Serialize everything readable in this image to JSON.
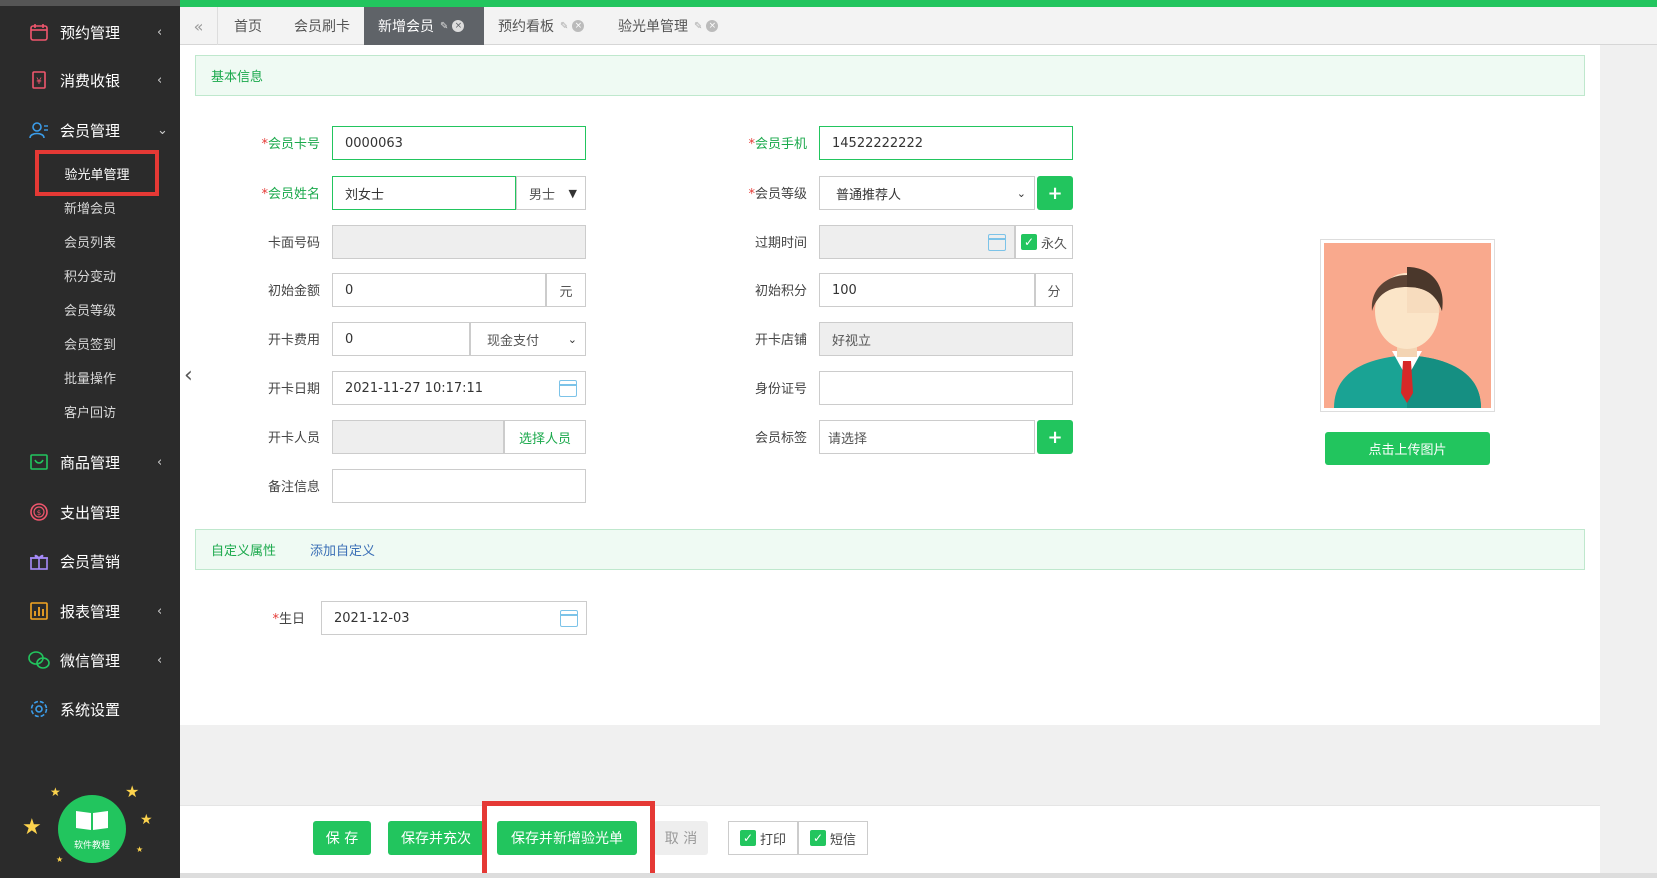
{
  "sidebar": {
    "menu": [
      {
        "label": "预约管理",
        "icon": "calendar-icon",
        "arrow": "‹"
      },
      {
        "label": "消费收银",
        "icon": "receipt-icon",
        "arrow": "‹"
      },
      {
        "label": "会员管理",
        "icon": "member-icon",
        "arrow": "⌄"
      },
      {
        "label": "商品管理",
        "icon": "product-icon",
        "arrow": "‹"
      },
      {
        "label": "支出管理",
        "icon": "expense-icon",
        "arrow": ""
      },
      {
        "label": "会员营销",
        "icon": "gift-icon",
        "arrow": ""
      },
      {
        "label": "报表管理",
        "icon": "report-icon",
        "arrow": "‹"
      },
      {
        "label": "微信管理",
        "icon": "wechat-icon",
        "arrow": "‹"
      },
      {
        "label": "系统设置",
        "icon": "gear-icon",
        "arrow": ""
      }
    ],
    "submenu": [
      "验光单管理",
      "新增会员",
      "会员列表",
      "积分变动",
      "会员等级",
      "会员签到",
      "批量操作",
      "客户回访"
    ],
    "tutorial_label": "软件教程"
  },
  "tabs": [
    {
      "label": "首页"
    },
    {
      "label": "会员刷卡"
    },
    {
      "label": "新增会员",
      "active": true
    },
    {
      "label": "预约看板"
    },
    {
      "label": "验光单管理"
    }
  ],
  "basic_section": {
    "title": "基本信息"
  },
  "form": {
    "card_no": {
      "label": "会员卡号",
      "value": "0000063"
    },
    "phone": {
      "label": "会员手机",
      "value": "14522222222"
    },
    "name": {
      "label": "会员姓名",
      "value": "刘女士",
      "gender": "男士"
    },
    "level": {
      "label": "会员等级",
      "value": "普通推荐人"
    },
    "face_no": {
      "label": "卡面号码",
      "value": ""
    },
    "expire": {
      "label": "过期时间",
      "value": "",
      "forever": "永久"
    },
    "init_amount": {
      "label": "初始金额",
      "value": "0",
      "unit": "元"
    },
    "init_points": {
      "label": "初始积分",
      "value": "100",
      "unit": "分"
    },
    "open_fee": {
      "label": "开卡费用",
      "value": "0",
      "pay_method": "现金支付"
    },
    "open_store": {
      "label": "开卡店铺",
      "value": "好视立"
    },
    "open_date": {
      "label": "开卡日期",
      "value": "2021-11-27 10:17:11"
    },
    "id_card": {
      "label": "身份证号",
      "value": ""
    },
    "open_staff": {
      "label": "开卡人员",
      "value": "",
      "select_label": "选择人员"
    },
    "tags": {
      "label": "会员标签",
      "placeholder": "请选择"
    },
    "remark": {
      "label": "备注信息",
      "value": ""
    }
  },
  "avatar": {
    "upload_label": "点击上传图片"
  },
  "custom_section": {
    "title": "自定义属性",
    "add_label": "添加自定义"
  },
  "birthday": {
    "label": "生日",
    "value": "2021-12-03"
  },
  "footer": {
    "save": "保 存",
    "save_recharge": "保存并充次",
    "save_new_optometry": "保存并新增验光单",
    "cancel": "取 消",
    "print": "打印",
    "sms": "短信"
  },
  "colors": {
    "accent": "#22c55e",
    "sidebar_bg": "#2b2b2b",
    "highlight": "#e53935"
  }
}
